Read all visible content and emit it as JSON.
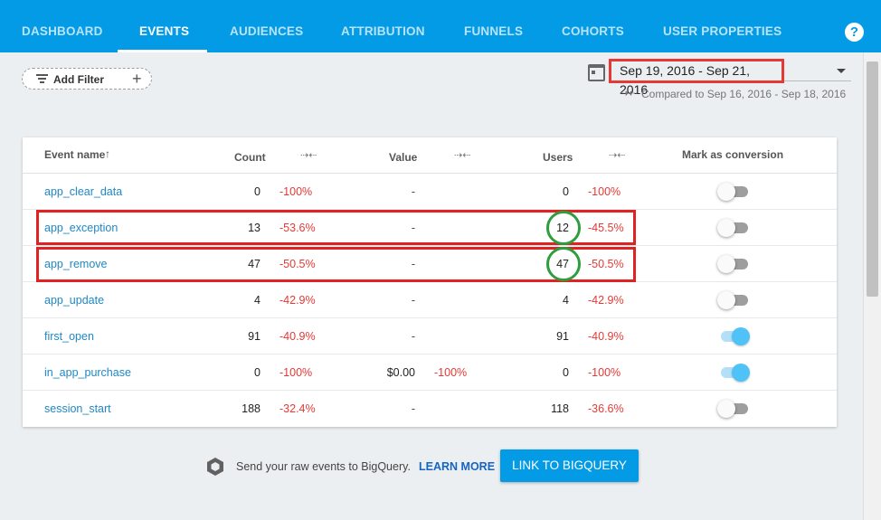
{
  "nav": {
    "tabs": [
      {
        "label": "DASHBOARD"
      },
      {
        "label": "EVENTS"
      },
      {
        "label": "AUDIENCES"
      },
      {
        "label": "ATTRIBUTION"
      },
      {
        "label": "FUNNELS"
      },
      {
        "label": "COHORTS"
      },
      {
        "label": "USER PROPERTIES"
      }
    ],
    "active_tab": "EVENTS",
    "help_label": "?"
  },
  "filter": {
    "add_filter_label": "Add Filter",
    "add_symbol": "+"
  },
  "date_range": {
    "value": "Sep 19, 2016 - Sep 21, 2016",
    "compared_to": "Compared to Sep 16, 2016 - Sep 18, 2016"
  },
  "table": {
    "headers": {
      "event_name": "Event name",
      "count": "Count",
      "value": "Value",
      "users": "Users",
      "mark_as_conversion": "Mark as conversion"
    },
    "rows": [
      {
        "event": "app_clear_data",
        "count": "0",
        "count_change": "-100%",
        "value": "-",
        "value_change": "",
        "users": "0",
        "users_change": "-100%",
        "conversion": false
      },
      {
        "event": "app_exception",
        "count": "13",
        "count_change": "-53.6%",
        "value": "-",
        "value_change": "",
        "users": "12",
        "users_change": "-45.5%",
        "conversion": false
      },
      {
        "event": "app_remove",
        "count": "47",
        "count_change": "-50.5%",
        "value": "-",
        "value_change": "",
        "users": "47",
        "users_change": "-50.5%",
        "conversion": false
      },
      {
        "event": "app_update",
        "count": "4",
        "count_change": "-42.9%",
        "value": "-",
        "value_change": "",
        "users": "4",
        "users_change": "-42.9%",
        "conversion": false
      },
      {
        "event": "first_open",
        "count": "91",
        "count_change": "-40.9%",
        "value": "-",
        "value_change": "",
        "users": "91",
        "users_change": "-40.9%",
        "conversion": true
      },
      {
        "event": "in_app_purchase",
        "count": "0",
        "count_change": "-100%",
        "value": "$0.00",
        "value_change": "-100%",
        "users": "0",
        "users_change": "-100%",
        "conversion": true
      },
      {
        "event": "session_start",
        "count": "188",
        "count_change": "-32.4%",
        "value": "-",
        "value_change": "",
        "users": "118",
        "users_change": "-36.6%",
        "conversion": false
      }
    ]
  },
  "bigquery": {
    "text": "Send your raw events to BigQuery.",
    "learn_more": "LEARN MORE",
    "button": "LINK TO BIGQUERY"
  },
  "colors": {
    "brand": "#039be5",
    "negative_change": "#e53935",
    "event_link": "#1e88c5",
    "annotation_red": "#e02222",
    "annotation_green": "#2e9d3e"
  },
  "icons": [
    "help-icon",
    "filter-icon",
    "plus-icon",
    "calendar-icon",
    "dropdown-arrow-icon",
    "compare-arrows-icon",
    "sort-arrow-up-icon",
    "bigquery-icon"
  ]
}
